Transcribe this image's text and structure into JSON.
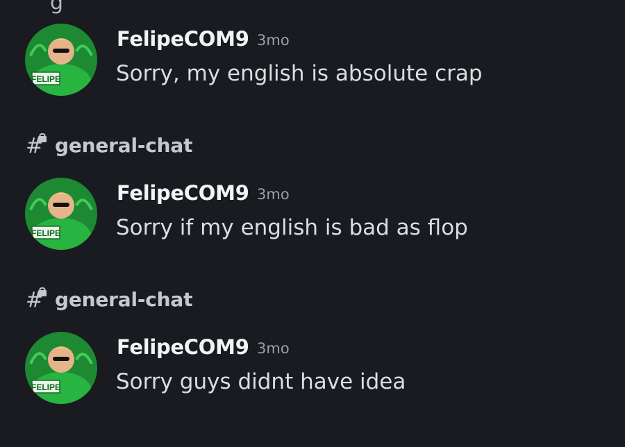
{
  "top_fragment": "g",
  "results": [
    {
      "channel": "",
      "username": "FelipeCOM9",
      "timestamp": "3mo",
      "message": "Sorry, my english is absolute crap",
      "avatar_label": "FELIPE"
    },
    {
      "channel": "general-chat",
      "username": "FelipeCOM9",
      "timestamp": "3mo",
      "message": "Sorry if my english is bad as flop",
      "avatar_label": "FELIPE"
    },
    {
      "channel": "general-chat",
      "username": "FelipeCOM9",
      "timestamp": "3mo",
      "message": "Sorry guys didnt have idea",
      "avatar_label": "FELIPE"
    }
  ],
  "icons": {
    "channel": "locked-text-channel-icon",
    "avatar": "user-avatar"
  },
  "colors": {
    "background": "#1a1b20",
    "username": "#f2f3f5",
    "message": "#dbdee1",
    "timestamp": "#9a9fa8",
    "avatar_green": "#1fa83a"
  }
}
